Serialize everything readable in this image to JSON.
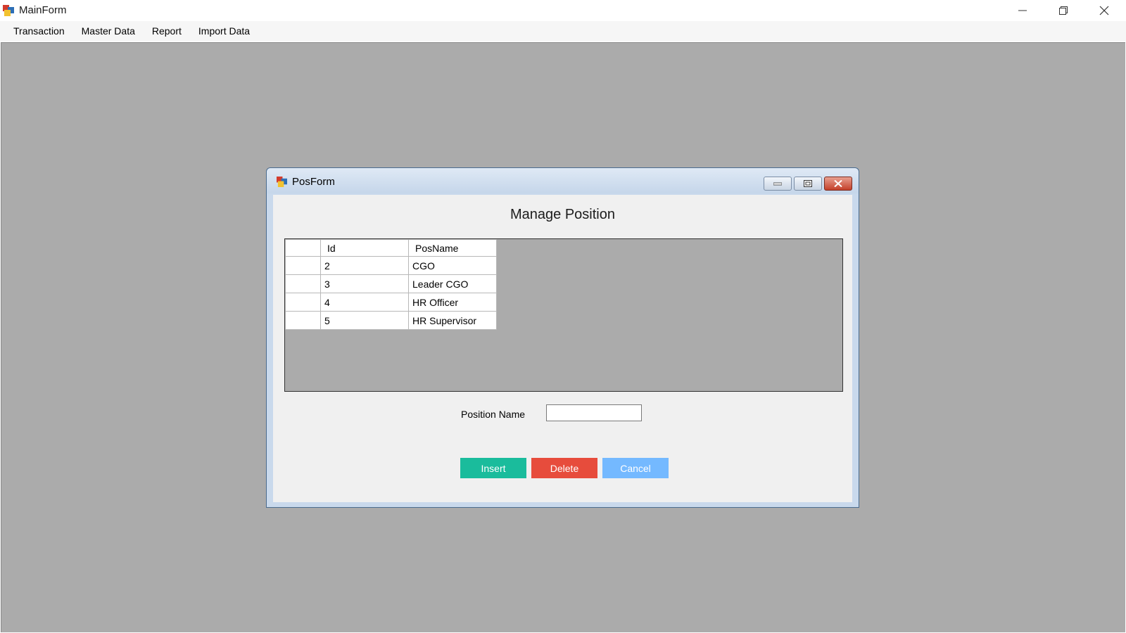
{
  "window": {
    "title": "MainForm"
  },
  "menu": {
    "items": [
      "Transaction",
      "Master Data",
      "Report",
      "Import Data"
    ]
  },
  "child_form": {
    "title": "PosForm",
    "heading": "Manage Position"
  },
  "grid": {
    "columns": [
      "Id",
      "PosName"
    ],
    "rows": [
      {
        "id": "2",
        "name": "CGO"
      },
      {
        "id": "3",
        "name": "Leader CGO"
      },
      {
        "id": "4",
        "name": "HR Officer"
      },
      {
        "id": "5",
        "name": "HR Supervisor"
      }
    ]
  },
  "form": {
    "position_label": "Position Name",
    "position_value": ""
  },
  "buttons": {
    "insert": "Insert",
    "delete": "Delete",
    "cancel": "Cancel"
  },
  "colors": {
    "insert": "#1abc9c",
    "delete": "#e74c3c",
    "cancel": "#74b9ff",
    "mdi_background": "#ababab"
  },
  "icons": {
    "app": "app-form-icon",
    "minimize": "minimize-icon",
    "maximize": "maximize-icon",
    "close": "close-icon"
  }
}
